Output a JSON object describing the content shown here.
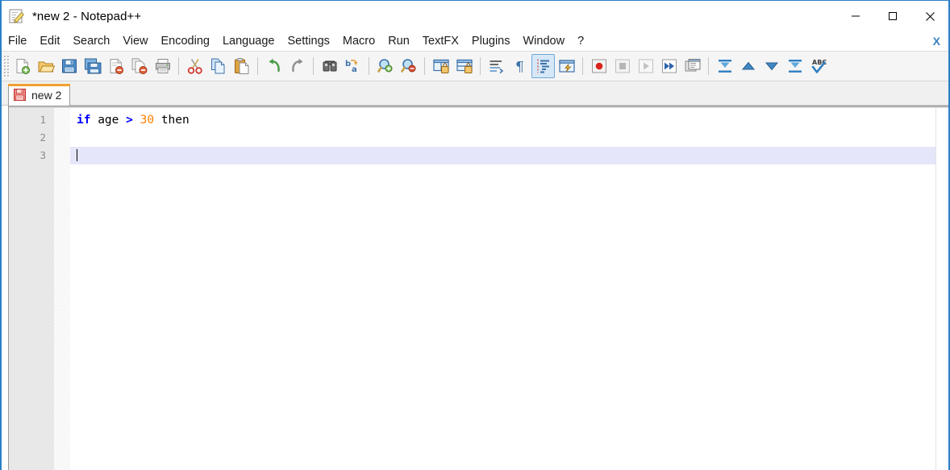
{
  "window": {
    "title": "*new  2 - Notepad++",
    "app_icon": "notepad-plus-plus-icon",
    "accent_border": "#2a7fc9",
    "controls": [
      {
        "name": "minimize",
        "glyph": "minimize-icon"
      },
      {
        "name": "maximize",
        "glyph": "maximize-icon"
      },
      {
        "name": "close",
        "glyph": "close-icon"
      }
    ]
  },
  "menubar": {
    "items": [
      {
        "label": "File"
      },
      {
        "label": "Edit"
      },
      {
        "label": "Search"
      },
      {
        "label": "View"
      },
      {
        "label": "Encoding"
      },
      {
        "label": "Language"
      },
      {
        "label": "Settings"
      },
      {
        "label": "Macro"
      },
      {
        "label": "Run"
      },
      {
        "label": "TextFX"
      },
      {
        "label": "Plugins"
      },
      {
        "label": "Window"
      },
      {
        "label": "?"
      }
    ],
    "close_document_label": "X"
  },
  "toolbar": {
    "groups": [
      {
        "buttons": [
          {
            "name": "new-file-icon",
            "tooltip": "New",
            "enabled": true
          },
          {
            "name": "open-file-icon",
            "tooltip": "Open",
            "enabled": true
          },
          {
            "name": "save-icon",
            "tooltip": "Save",
            "enabled": true
          },
          {
            "name": "save-all-icon",
            "tooltip": "Save All",
            "enabled": true
          },
          {
            "name": "close-file-icon",
            "tooltip": "Close",
            "enabled": true
          },
          {
            "name": "close-all-files-icon",
            "tooltip": "Close All",
            "enabled": true
          },
          {
            "name": "print-icon",
            "tooltip": "Print",
            "enabled": true
          }
        ]
      },
      {
        "buttons": [
          {
            "name": "cut-icon",
            "tooltip": "Cut",
            "enabled": true
          },
          {
            "name": "copy-icon",
            "tooltip": "Copy",
            "enabled": true
          },
          {
            "name": "paste-icon",
            "tooltip": "Paste",
            "enabled": true
          }
        ]
      },
      {
        "buttons": [
          {
            "name": "undo-icon",
            "tooltip": "Undo",
            "enabled": true
          },
          {
            "name": "redo-icon",
            "tooltip": "Redo",
            "enabled": true
          }
        ]
      },
      {
        "buttons": [
          {
            "name": "find-icon",
            "tooltip": "Find",
            "enabled": true
          },
          {
            "name": "replace-icon",
            "tooltip": "Replace",
            "enabled": true
          }
        ]
      },
      {
        "buttons": [
          {
            "name": "zoom-in-icon",
            "tooltip": "Zoom In",
            "enabled": true
          },
          {
            "name": "zoom-out-icon",
            "tooltip": "Zoom Out",
            "enabled": true
          }
        ]
      },
      {
        "buttons": [
          {
            "name": "sync-vertical-scroll-icon",
            "tooltip": "Synchronize Vertical Scrolling",
            "enabled": true
          },
          {
            "name": "sync-horizontal-scroll-icon",
            "tooltip": "Synchronize Horizontal Scrolling",
            "enabled": true
          }
        ]
      },
      {
        "buttons": [
          {
            "name": "word-wrap-icon",
            "tooltip": "Word wrap",
            "enabled": true
          },
          {
            "name": "show-all-characters-icon",
            "tooltip": "Show All Characters",
            "enabled": true
          },
          {
            "name": "indent-guide-icon",
            "tooltip": "Show Indent Guide",
            "enabled": true,
            "active": true
          },
          {
            "name": "user-defined-dialog-icon",
            "tooltip": "User Defined Dialogue",
            "enabled": true
          }
        ]
      },
      {
        "buttons": [
          {
            "name": "macro-record-icon",
            "tooltip": "Start Recording",
            "enabled": true
          },
          {
            "name": "macro-stop-icon",
            "tooltip": "Stop Recording",
            "enabled": false
          },
          {
            "name": "macro-play-icon",
            "tooltip": "Playback",
            "enabled": false
          },
          {
            "name": "macro-run-multiple-icon",
            "tooltip": "Run a Macro Multiple Times",
            "enabled": true
          },
          {
            "name": "macro-save-icon",
            "tooltip": "Save Current Recorded Macro",
            "enabled": true
          }
        ]
      },
      {
        "buttons": [
          {
            "name": "collapse-all-icon",
            "tooltip": "Collapse All",
            "enabled": true
          },
          {
            "name": "fold-level-up-icon",
            "tooltip": "Fold Level Up",
            "enabled": true
          },
          {
            "name": "fold-level-down-icon",
            "tooltip": "Fold Level Down",
            "enabled": true
          },
          {
            "name": "expand-all-icon",
            "tooltip": "Uncollapse All",
            "enabled": true
          },
          {
            "name": "spell-check-icon",
            "tooltip": "Spell Check",
            "enabled": true
          }
        ]
      }
    ]
  },
  "tabs": [
    {
      "label": "new  2",
      "icon": "unsaved-floppy-icon",
      "active": true,
      "modified": true,
      "active_marker_color": "#f0a030"
    }
  ],
  "editor": {
    "gutter_lines": [
      "1",
      "2",
      "3"
    ],
    "current_line": 3,
    "current_line_color": "#e6e6fa",
    "lines": [
      {
        "number": "1",
        "text": "if age > 30 then",
        "tokens": [
          {
            "text": "if",
            "type": "keyword",
            "color": "#0000ff"
          },
          {
            "text": " ",
            "type": "space"
          },
          {
            "text": "age",
            "type": "identifier",
            "color": "#000000"
          },
          {
            "text": " ",
            "type": "space"
          },
          {
            "text": ">",
            "type": "operator",
            "color": "#0000ff"
          },
          {
            "text": " ",
            "type": "space"
          },
          {
            "text": "30",
            "type": "number",
            "color": "#ff8000"
          },
          {
            "text": " ",
            "type": "space"
          },
          {
            "text": "then",
            "type": "identifier",
            "color": "#000000"
          }
        ]
      },
      {
        "number": "2",
        "text": "",
        "tokens": []
      },
      {
        "number": "3",
        "text": "",
        "tokens": []
      }
    ]
  }
}
